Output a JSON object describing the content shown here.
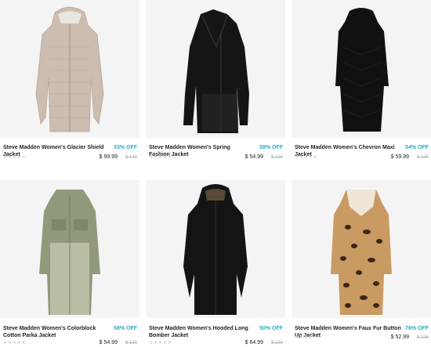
{
  "products": [
    {
      "name": "Steve Madden Women's Glacier Shield Jacket",
      "off": "33% OFF",
      "price": "$ 99.99",
      "original": "$ 149",
      "rating_stars": "★★★★★",
      "image_icon": "puffer-coat-beige"
    },
    {
      "name": "Steve Madden Women's Spring Fashion Jacket",
      "off": "58% OFF",
      "price": "$ 54.99",
      "original": "$ 130",
      "rating_stars": "★★★★★",
      "image_icon": "moto-coat-black"
    },
    {
      "name": "Steve Madden Women's Chevron Maxi Jacket",
      "off": "54% OFF",
      "price": "$ 59.99",
      "original": "$ 130",
      "rating_stars": "★★★★★",
      "image_icon": "maxi-puffer-black"
    },
    {
      "name": "Steve Madden Women's Colorblock Cotton Parka Jacket",
      "off": "58% OFF",
      "price": "$ 54.99",
      "original": "$ 130",
      "rating_stars": "★★★★★",
      "image_icon": "parka-olive"
    },
    {
      "name": "Steve Madden Women's Hooded Long Bomber Jacket",
      "off": "50% OFF",
      "price": "$ 64.99",
      "original": "$ 130",
      "rating_stars": "★★★★★",
      "image_icon": "bomber-black"
    },
    {
      "name": "Steve Madden Women's Faux Fur Button Up Jacket",
      "off": "76% OFF",
      "price": "$ 52.99",
      "original": "$ 225",
      "rating_stars": "★★★★★",
      "image_icon": "leopard-coat"
    }
  ],
  "colors": {
    "accent": "#2aa7c7",
    "text": "#222222",
    "muted": "#b5b5b5",
    "tile_bg": "#f4f4f4"
  }
}
